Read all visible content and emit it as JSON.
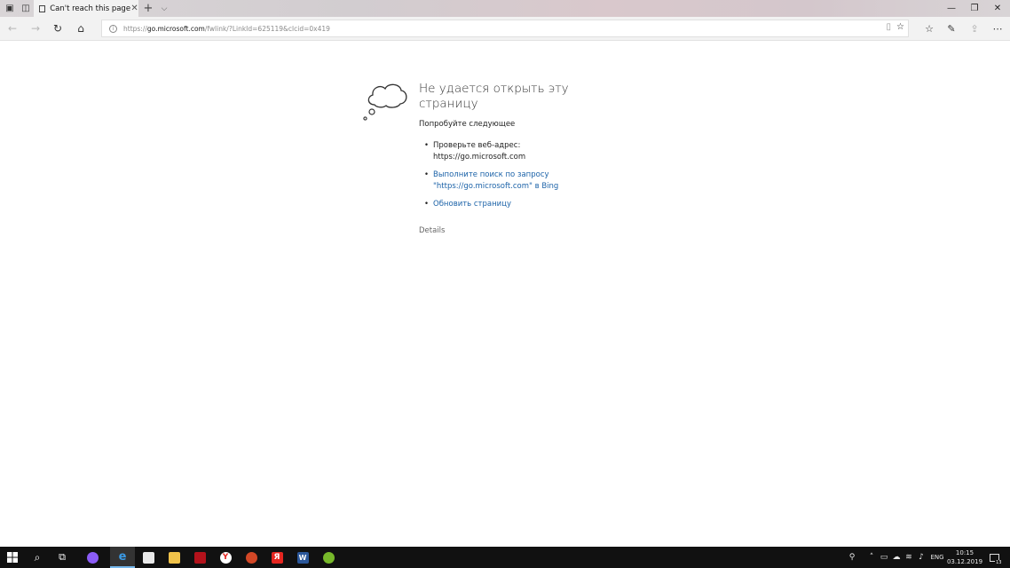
{
  "browser": {
    "tab_title": "Can't reach this page",
    "url_scheme": "https://",
    "url_host": "go.microsoft.com",
    "url_path": "/fwlink/?LinkId=625119&clcid=0x419"
  },
  "error_page": {
    "title": "Не удается открыть эту страницу",
    "subtitle": "Попробуйте следующее",
    "suggestions": [
      {
        "text": "Проверьте веб-адрес: https://go.microsoft.com",
        "link": false
      },
      {
        "text": "Выполните поиск по запросу \"https://go.microsoft.com\" в Bing",
        "link": true
      },
      {
        "text": "Обновить страницу",
        "link": true
      }
    ],
    "details_label": "Details"
  },
  "taskbar": {
    "language": "ENG",
    "time": "10:15",
    "date": "03.12.2019",
    "notification_count": "13"
  },
  "colors": {
    "link": "#1b62a8",
    "edge_accent": "#76b9ed",
    "taskbar_bg": "#111111"
  }
}
